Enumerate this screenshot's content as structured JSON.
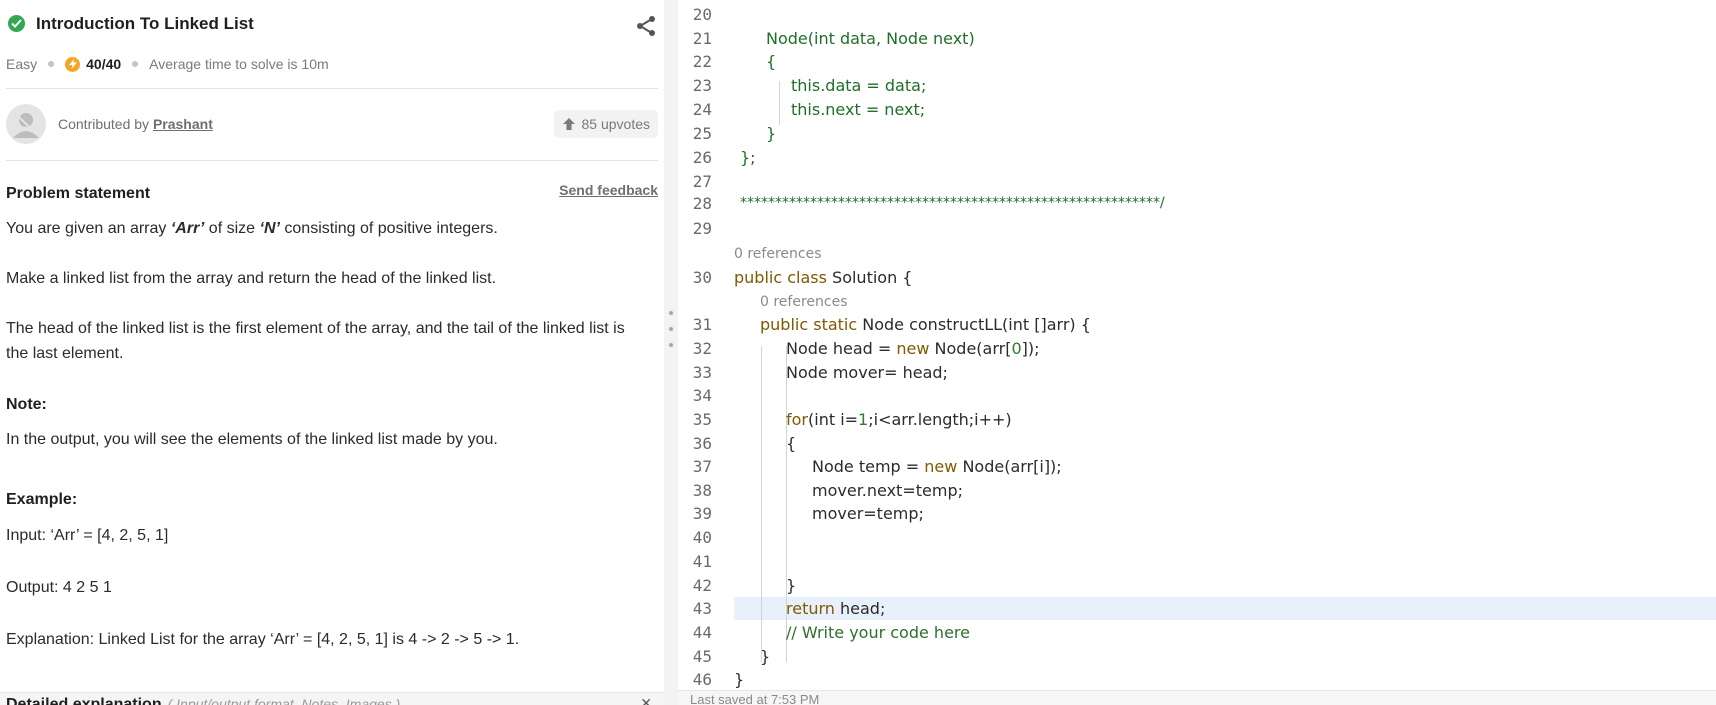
{
  "problem": {
    "title": "Introduction To Linked List",
    "difficulty": "Easy",
    "score": "40/40",
    "avg_time": "Average time to solve is 10m",
    "contributed_prefix": "Contributed by ",
    "contributor": "Prashant",
    "upvotes": "85 upvotes",
    "statement_heading": "Problem statement",
    "send_feedback": "Send feedback",
    "p1_a": "You are given an array ",
    "p1_arr": "‘Arr’",
    "p1_b": " of size ",
    "p1_n": "‘N’",
    "p1_c": " consisting of positive integers.",
    "p2": "Make a linked list from the array and return the head of the linked list.",
    "p3": "The head of the linked list is the first element of the array, and the tail of the linked list is the last element.",
    "note_heading": "Note:",
    "note_text": "In the output, you will see the elements of the linked list made by you.",
    "example_heading": "Example:",
    "input": "Input: ‘Arr’ = [4, 2, 5, 1]",
    "output": "Output: 4 2 5 1",
    "explanation": "Explanation: Linked List for the array ‘Arr’ = [4, 2, 5, 1] is 4 -> 2 -> 5 -> 1.",
    "detailed_heading": "Detailed explanation",
    "detailed_sub": "( Input/output format, Notes, Images )"
  },
  "editor": {
    "line_numbers": [
      "20",
      "21",
      "22",
      "23",
      "24",
      "25",
      "26",
      "27",
      "28",
      "29",
      "30",
      "31",
      "32",
      "33",
      "34",
      "35",
      "36",
      "37",
      "38",
      "39",
      "40",
      "41",
      "42",
      "43",
      "44",
      "45",
      "46"
    ],
    "references_1": "0 references",
    "references_2": "0 references",
    "code": {
      "l21": "Node(int data, Node next)",
      "l22": "{",
      "l23": "this.data = data;",
      "l24": "this.next = next;",
      "l25": "}",
      "l26": "};",
      "l28": "************************************************************/",
      "l30_kw": "public class",
      "l30_rest": " Solution {",
      "l31_kw": "public static",
      "l31_rest": " Node constructLL(int []arr) {",
      "l32_a": "Node head = ",
      "l32_kw": "new",
      "l32_b": " Node(arr[",
      "l32_num": "0",
      "l32_c": "]);",
      "l33": "Node mover= head;",
      "l35_kw": "for",
      "l35_a": "(int i=",
      "l35_num": "1",
      "l35_b": ";i<arr.length;i++)",
      "l36": "{",
      "l37_a": "Node temp = ",
      "l37_kw": "new",
      "l37_b": " Node(arr[i]);",
      "l38": "mover.next=temp;",
      "l39": "mover=temp;",
      "l42": "}",
      "l43_kw": "return",
      "l43_rest": " head;",
      "l44": "// Write your code here",
      "l45": "}",
      "l46": "}"
    },
    "last_saved": "Last saved at 7:53 PM"
  },
  "colors": {
    "accent_green": "#33a852",
    "bolt": "#f5a623",
    "keyword": "#7f5a00",
    "comment": "#2f6f2f",
    "highlight_line": "#e8f0fb"
  }
}
